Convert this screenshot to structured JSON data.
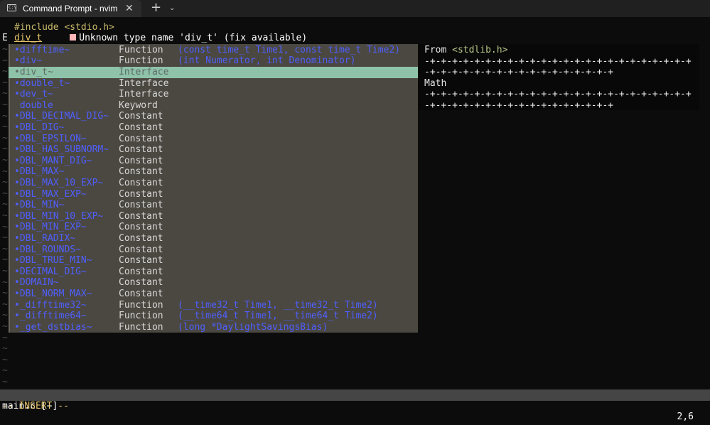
{
  "window": {
    "tab_title": "Command Prompt - nvim",
    "tab_icon_text": "C:\\",
    "close_glyph": "✕",
    "new_tab_glyph": "+",
    "dropdown_glyph": "⌄"
  },
  "editor": {
    "include_keyword": "#include",
    "include_file": "<stdio.h>",
    "error_sign": "E",
    "error_word": "div_t",
    "diagnostic": "Unknown type name 'div_t' (fix available)",
    "filler": "~"
  },
  "completion": {
    "items": [
      {
        "abbr": "•difftime~",
        "kind": "Function",
        "menu": "(const time_t Time1, const time_t Time2)"
      },
      {
        "abbr": "•div~",
        "kind": "Function",
        "menu": "(int Numerator, int Denominator)"
      },
      {
        "abbr": "•div_t~",
        "kind": "Interface",
        "menu": ""
      },
      {
        "abbr": "•double_t~",
        "kind": "Interface",
        "menu": ""
      },
      {
        "abbr": "•dev_t~",
        "kind": "Interface",
        "menu": ""
      },
      {
        "abbr": " double",
        "kind": "Keyword",
        "menu": ""
      },
      {
        "abbr": "•DBL_DECIMAL_DIG~",
        "kind": "Constant",
        "menu": ""
      },
      {
        "abbr": "•DBL_DIG~",
        "kind": "Constant",
        "menu": ""
      },
      {
        "abbr": "•DBL_EPSILON~",
        "kind": "Constant",
        "menu": ""
      },
      {
        "abbr": "•DBL_HAS_SUBNORM~",
        "kind": "Constant",
        "menu": ""
      },
      {
        "abbr": "•DBL_MANT_DIG~",
        "kind": "Constant",
        "menu": ""
      },
      {
        "abbr": "•DBL_MAX~",
        "kind": "Constant",
        "menu": ""
      },
      {
        "abbr": "•DBL_MAX_10_EXP~",
        "kind": "Constant",
        "menu": ""
      },
      {
        "abbr": "•DBL_MAX_EXP~",
        "kind": "Constant",
        "menu": ""
      },
      {
        "abbr": "•DBL_MIN~",
        "kind": "Constant",
        "menu": ""
      },
      {
        "abbr": "•DBL_MIN_10_EXP~",
        "kind": "Constant",
        "menu": ""
      },
      {
        "abbr": "•DBL_MIN_EXP~",
        "kind": "Constant",
        "menu": ""
      },
      {
        "abbr": "•DBL_RADIX~",
        "kind": "Constant",
        "menu": ""
      },
      {
        "abbr": "•DBL_ROUNDS~",
        "kind": "Constant",
        "menu": ""
      },
      {
        "abbr": "•DBL_TRUE_MIN~",
        "kind": "Constant",
        "menu": ""
      },
      {
        "abbr": "•DECIMAL_DIG~",
        "kind": "Constant",
        "menu": ""
      },
      {
        "abbr": "•DOMAIN~",
        "kind": "Constant",
        "menu": ""
      },
      {
        "abbr": "•DBL_NORM_MAX~",
        "kind": "Constant",
        "menu": ""
      },
      {
        "abbr": "•_difftime32~",
        "kind": "Function",
        "menu": "(__time32_t Time1, __time32_t Time2)"
      },
      {
        "abbr": "•_difftime64~",
        "kind": "Function",
        "menu": "(__time64_t Time1, __time64_t Time2)"
      },
      {
        "abbr": "•_get_dstbias~",
        "kind": "Function",
        "menu": "(long *DaylightSavingsBias)"
      }
    ]
  },
  "doc": {
    "from_label": "From",
    "header": "<stdlib.h>",
    "rule_1": "-+-+-+-+-+-+-+-+-+-+-+-+-+-+-+-+-+-+-+-+-+-+-+-+",
    "rule_2": "-+-+-+-+-+-+-+-+-+-+-+-+-+-+-+-+-+",
    "section": "Math",
    "rule_3": "-+-+-+-+-+-+-+-+-+-+-+-+-+-+-+-+-+-+-+-+-+-+-+-+",
    "rule_4": "-+-+-+-+-+-+-+-+-+-+-+-+-+-+-+-+-+"
  },
  "statusline": {
    "filename": "main.c [+]",
    "position": "2,6"
  },
  "cmdline": {
    "mode": "-- INSERT --"
  }
}
